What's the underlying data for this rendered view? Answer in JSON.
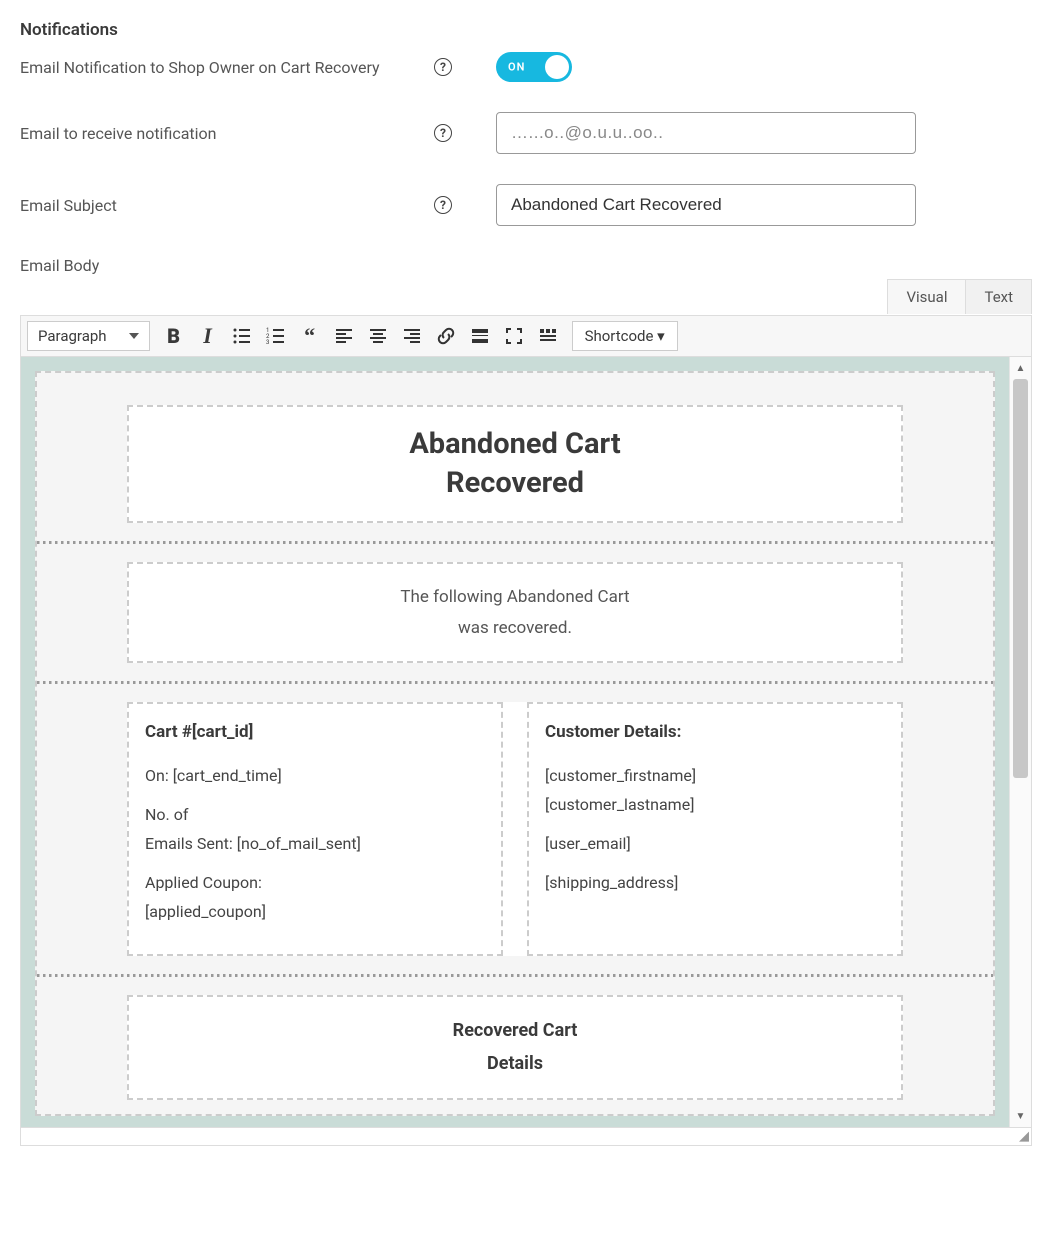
{
  "section_title": "Notifications",
  "rows": {
    "notify_owner": {
      "label": "Email Notification to Shop Owner on Cart Recovery",
      "toggle_text": "ON"
    },
    "email_to": {
      "label": "Email to receive notification",
      "value": "…...o..@o.u.u..oo.."
    },
    "subject": {
      "label": "Email Subject",
      "value": "Abandoned Cart Recovered"
    },
    "body": {
      "label": "Email Body"
    }
  },
  "tabs": {
    "visual": "Visual",
    "text": "Text"
  },
  "toolbar": {
    "format_label": "Paragraph",
    "shortcode": "Shortcode ▾"
  },
  "email_template": {
    "title_l1": "Abandoned Cart",
    "title_l2": "Recovered",
    "intro_l1": "The following Abandoned Cart",
    "intro_l2": "was recovered.",
    "left": {
      "heading": "Cart #[cart_id]",
      "line1": "On: [cart_end_time]",
      "line2a": "No. of",
      "line2b": "Emails Sent: [no_of_mail_sent]",
      "line3a": "Applied Coupon:",
      "line3b": "[applied_coupon]"
    },
    "right": {
      "heading": "Customer Details:",
      "line1": "[customer_firstname]",
      "line2": "[customer_lastname]",
      "line3": "[user_email]",
      "line4": "[shipping_address]"
    },
    "bottom_heading_l1": "Recovered Cart",
    "bottom_heading_l2": "Details"
  }
}
